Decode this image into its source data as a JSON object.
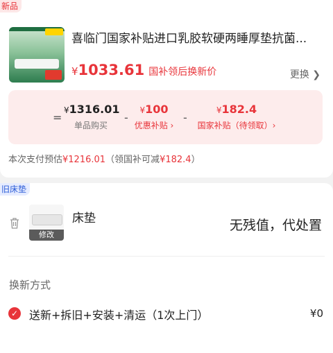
{
  "new_item": {
    "tag": "新品",
    "title": "喜临门国家补贴进口乳胶软硬两睡厚垫抗菌...",
    "price_currency": "¥",
    "price": "1033.61",
    "price_note": "国补领后换新价",
    "change_label": "更换 ❯"
  },
  "breakdown": {
    "op_eq": "=",
    "op_minus": "-",
    "unit_price": {
      "currency": "¥",
      "value": "1316.01",
      "label": "单品购买"
    },
    "discount": {
      "currency": "¥",
      "value": "100",
      "label": "优惠补贴 ›"
    },
    "gov_subsidy": {
      "currency": "¥",
      "value": "182.4",
      "label": "国家补贴（待领取）›"
    }
  },
  "estimate": {
    "prefix": "本次支付预估",
    "amount": "¥1216.01",
    "mid": "（领国补可减",
    "reduce": "¥182.4",
    "suffix": "）"
  },
  "old_item": {
    "tag": "旧床垫",
    "name": "床垫",
    "edit_label": "修改",
    "residual": "无残值，代处置"
  },
  "renew": {
    "label": "换新方式",
    "option_text": "送新+拆旧+安装+清运（1次上门）",
    "option_price": "¥0"
  },
  "colors": {
    "accent": "#e8343a",
    "breakdown_bg": "#fdecec",
    "old_tag": "#2a5bd7"
  },
  "icons": [
    "trash-icon",
    "check-icon",
    "chevron-right-icon"
  ]
}
